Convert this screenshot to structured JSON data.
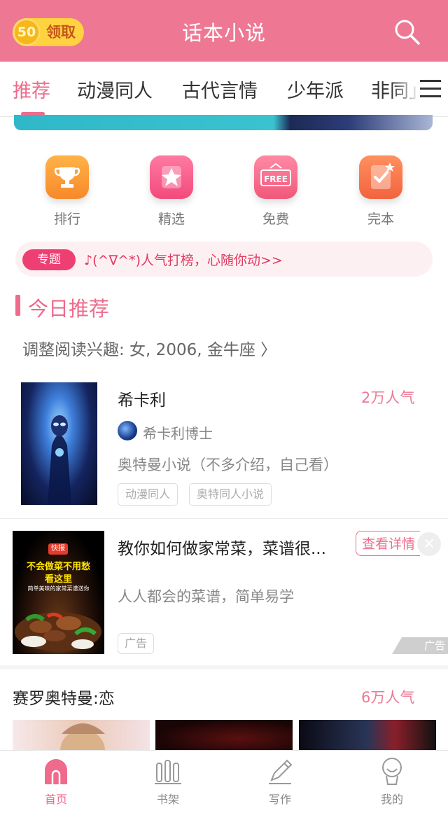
{
  "header": {
    "coin_value": "50",
    "coin_label": "领取",
    "title": "话本小说",
    "search_icon": "search-icon"
  },
  "tabs": [
    {
      "label": "推荐",
      "active": true
    },
    {
      "label": "动漫同人",
      "active": false
    },
    {
      "label": "古代言情",
      "active": false
    },
    {
      "label": "少年派",
      "active": false
    },
    {
      "label": "非同」",
      "active": false
    }
  ],
  "quick_links": [
    {
      "label": "排行",
      "icon": "trophy-icon"
    },
    {
      "label": "精选",
      "icon": "star-icon"
    },
    {
      "label": "免费",
      "icon": "free-tag-icon",
      "icon_text": "FREE"
    },
    {
      "label": "完本",
      "icon": "checklist-icon"
    }
  ],
  "topic": {
    "badge": "专题",
    "text": "♪(^∇^*)人气打榜，心随你动>>"
  },
  "section": {
    "title": "今日推荐",
    "preference": "调整阅读兴趣: 女, 2006, 金牛座 〉"
  },
  "book": {
    "title": "希卡利",
    "popularity": "2万人气",
    "author": "希卡利博士",
    "description": "奥特曼小说（不多介绍，自己看）",
    "tags": [
      "动漫同人",
      "奥特同人小说"
    ]
  },
  "ad": {
    "image_badge": "快报",
    "image_line1": "不会做菜不用愁",
    "image_line2": "看这里",
    "image_line3": "简单美味的家常菜谱送你",
    "title": "教你如何做家常菜，菜谱很...",
    "button": "查看详情",
    "close": "×",
    "description": "人人都会的菜谱，简单易学",
    "tag": "广告",
    "corner_label": "广告"
  },
  "series": {
    "title": "赛罗奥特曼:恋",
    "popularity": "6万人气"
  },
  "bottom_nav": [
    {
      "label": "首页",
      "icon": "home-icon",
      "active": true
    },
    {
      "label": "书架",
      "icon": "bookshelf-icon",
      "active": false
    },
    {
      "label": "写作",
      "icon": "pen-icon",
      "active": false
    },
    {
      "label": "我的",
      "icon": "profile-icon",
      "active": false
    }
  ],
  "colors": {
    "brand_pink": "#ee7894",
    "accent_pink": "#ee6b8c",
    "coin_yellow": "#ffd33f"
  }
}
